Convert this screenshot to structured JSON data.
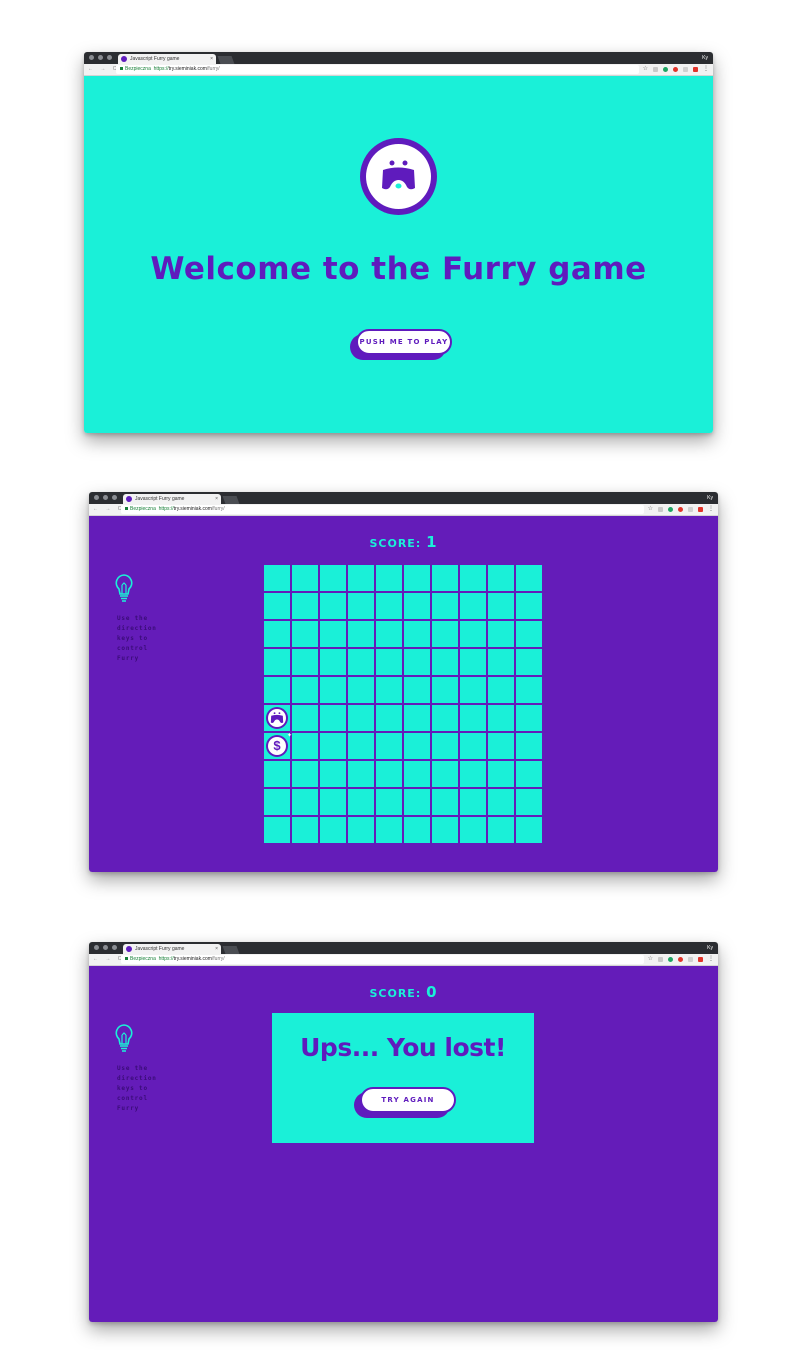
{
  "browser": {
    "tab_title": "Javascript Furry game",
    "tab_close": "×",
    "profile": "Ky",
    "nav": "← → C",
    "secure_label": "Bezpieczna",
    "url_scheme": "https://",
    "url_host": "try.sieminiak.com",
    "url_path": "/furry/"
  },
  "colors": {
    "teal": "#1af0d8",
    "purple": "#5f1bbd",
    "page_purple": "#641cb9"
  },
  "welcome": {
    "title": "Welcome to the Furry game",
    "play_button": "PUSH ME TO PLAY"
  },
  "game": {
    "score_label": "SCORE:",
    "score_value": "1",
    "hint": "Use the direction keys to control Furry",
    "grid_rows": 10,
    "grid_cols": 10,
    "furry_position": {
      "row": 6,
      "col": 1
    },
    "coin_position": {
      "row": 7,
      "col": 1
    },
    "coin_symbol": "$"
  },
  "lost": {
    "score_label": "SCORE:",
    "score_value": "0",
    "hint": "Use the direction keys to control Furry",
    "title": "Ups... You lost!",
    "try_again_button": "TRY AGAIN"
  }
}
